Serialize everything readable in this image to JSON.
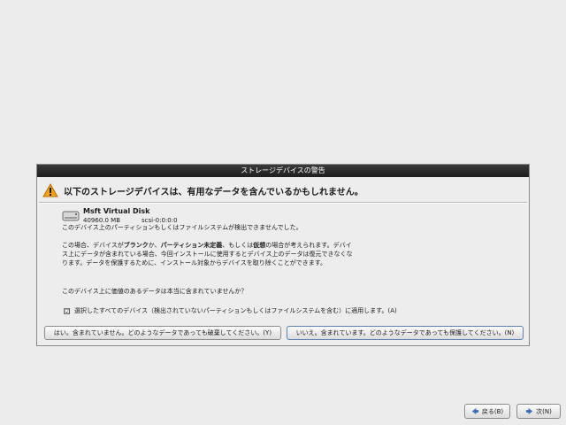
{
  "dialog": {
    "title": "ストレージデバイスの警告",
    "headline": "以下のストレージデバイスは、有用なデータを含んでいるかもしれません。",
    "device": {
      "name": "Msft Virtual Disk",
      "size": "40960.0 MB",
      "id": "scsi-0:0:0:0"
    },
    "paragraph1": "このデバイス上のパーティションもしくはファイルシステムが検出できませんでした。",
    "paragraph2_parts": {
      "a": "この場合、デバイスが",
      "b": "ブランク",
      "c": "か、",
      "d": "パーティション未定義",
      "e": "、もしくは",
      "f": "仮想",
      "g": "の場合が考えられます。デバイス上にデータが含まれている場合、今回インストールに使用するとデバイス上のデータは復元できなくなります。データを保護するために、インストール対象からデバイスを取り除くことができます。"
    },
    "paragraph3": "このデバイス上に価値のあるデータは本当に含まれていませんか？",
    "checkbox": {
      "checked": true,
      "mark": "☑",
      "label": "選択したすべてのデバイス（検出されていないパーティションもしくはファイルシステムを含む）に適用します。(A)"
    },
    "button_no": "はい。含まれていません。どのようなデータであっても破棄してください。(Y)",
    "button_yes": "いいえ。含まれています。どのようなデータであっても保護してください。(N)"
  },
  "nav": {
    "back_label": "戻る(B)",
    "next_label": "次(N)"
  },
  "colors": {
    "titlebar": "#1e1e1e",
    "warning_fill": "#f2a11c",
    "nav_arrow": "#3b6fb6"
  }
}
